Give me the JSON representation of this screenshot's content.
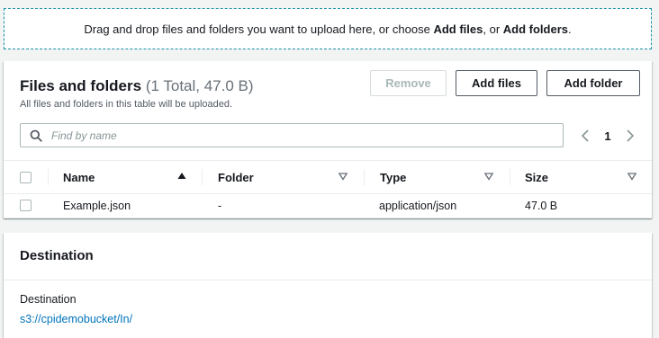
{
  "dropzone": {
    "text_before": "Drag and drop files and folders you want to upload here, or choose ",
    "add_files": "Add files",
    "text_middle": ", or ",
    "add_folders": "Add folders",
    "text_after": "."
  },
  "files_panel": {
    "title": "Files and folders",
    "count": "(1 Total, 47.0 B)",
    "description": "All files and folders in this table will be uploaded.",
    "buttons": {
      "remove": "Remove",
      "add_files": "Add files",
      "add_folder": "Add folder"
    },
    "search": {
      "placeholder": "Find by name",
      "value": ""
    },
    "pagination": {
      "current_page": "1"
    },
    "columns": [
      "Name",
      "Folder",
      "Type",
      "Size"
    ],
    "sort": {
      "column": "Name",
      "direction": "ascending"
    },
    "rows": [
      {
        "name": "Example.json",
        "folder": "-",
        "type": "application/json",
        "size": "47.0 B"
      }
    ]
  },
  "destination": {
    "title": "Destination",
    "label": "Destination",
    "link": "s3://cpidemobucket/In/"
  },
  "colors": {
    "dropzone_border": "#1a8fa8",
    "link": "#0073bb",
    "background": "#f2f3f3",
    "disabled_text": "#aab7b8"
  }
}
